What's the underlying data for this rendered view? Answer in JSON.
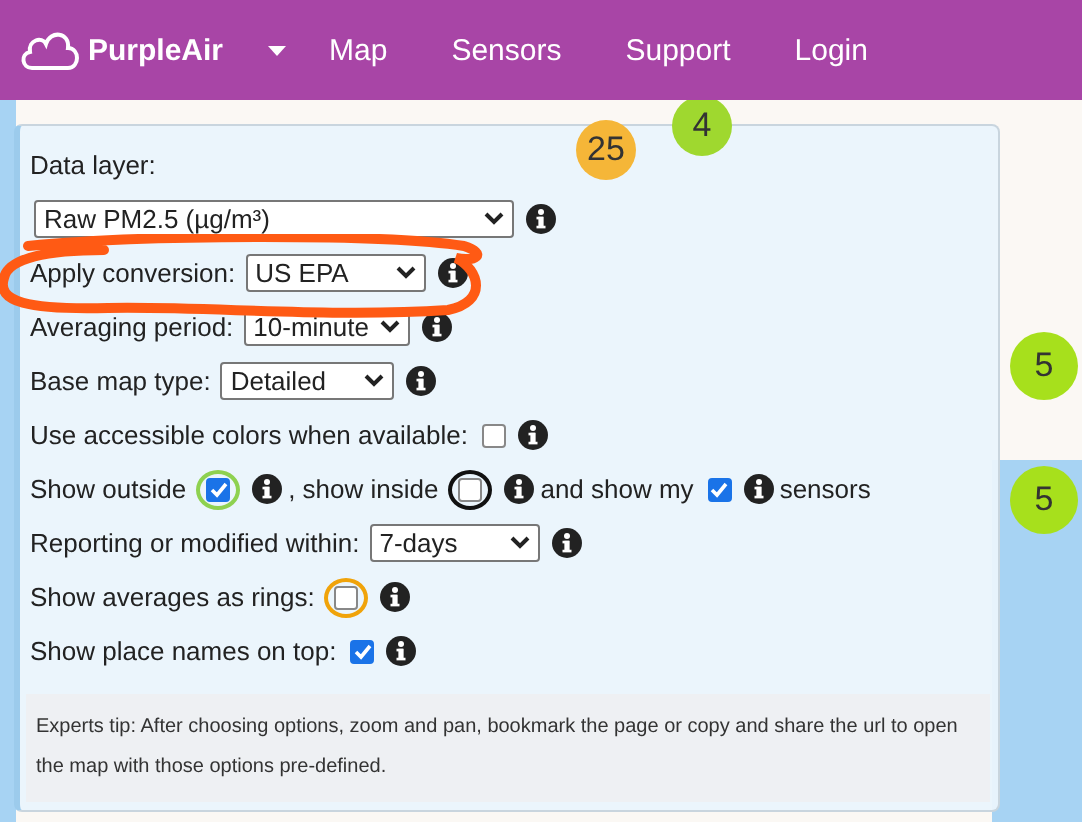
{
  "navbar": {
    "brand": "PurpleAir",
    "links": [
      {
        "label": "Map"
      },
      {
        "label": "Sensors"
      },
      {
        "label": "Support"
      },
      {
        "label": "Login"
      }
    ]
  },
  "map": {
    "markers": [
      {
        "label": "4",
        "color": "#9fd82f"
      },
      {
        "label": "25",
        "color": "#f5b638"
      },
      {
        "label": "5",
        "color": "#a7e01c"
      },
      {
        "label": "5",
        "color": "#a7e01c"
      }
    ]
  },
  "panel": {
    "rows": [
      {
        "kind": "heading",
        "label": "Data layer:"
      },
      {
        "kind": "select",
        "value": "Raw PM2.5 (µg/m³)"
      },
      {
        "kind": "select",
        "label": "Apply conversion:",
        "value": "US EPA"
      },
      {
        "kind": "select",
        "label": "Averaging period:",
        "value": "10-minute"
      },
      {
        "kind": "select",
        "label": "Base map type:",
        "value": "Detailed"
      },
      {
        "kind": "checkbox",
        "label": "Use accessible colors when available:",
        "checked": false
      },
      {
        "kind": "toggles",
        "items": [
          {
            "label": "Show outside",
            "checked": true,
            "color": "#8ed150"
          },
          {
            "label": ", show inside",
            "checked": false,
            "color": "#111111"
          },
          {
            "label": "and show my",
            "checked": true
          }
        ],
        "suffix": "sensors"
      },
      {
        "kind": "select",
        "label": "Reporting or modified within:",
        "value": "7-days"
      },
      {
        "kind": "checkbox",
        "label": "Show averages as rings:",
        "checked": false,
        "color": "#f0a30a"
      },
      {
        "kind": "checkbox",
        "label": "Show place names on top:",
        "checked": true
      }
    ],
    "tip": "Experts tip: After choosing options, zoom and pan, bookmark the page or copy and share the url to open the map with those options pre-defined."
  }
}
